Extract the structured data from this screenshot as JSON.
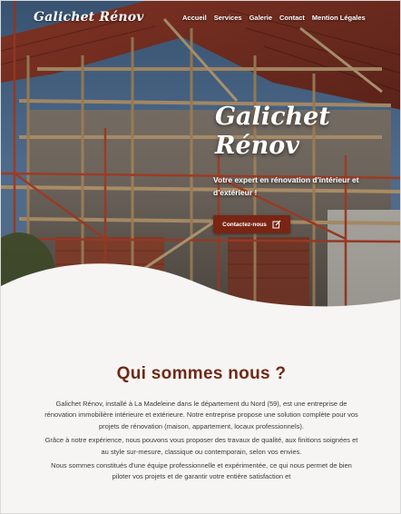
{
  "brand": {
    "logo_text": "Galichet Rénov"
  },
  "nav": {
    "items": [
      {
        "label": "Accueil"
      },
      {
        "label": "Services"
      },
      {
        "label": "Galerie"
      },
      {
        "label": "Contact"
      },
      {
        "label": "Mention Légales"
      }
    ]
  },
  "hero": {
    "title_line1": "Galichet",
    "title_line2": "Rénov",
    "subtitle": "Votre expert en rénovation d'intérieur et d'extérieur !",
    "cta_label": "Contactez-nous",
    "cta_icon": "edit-icon",
    "image_icon": "construction-house-photo"
  },
  "about": {
    "title": "Qui sommes nous ?",
    "paragraphs": [
      "Galichet Rénov, installé à La Madeleine dans le département du Nord (59), est une entreprise de rénovation immobilière intérieure et extérieure. Notre entreprise propose une solution complète pour vos projets de rénovation (maison, appartement, locaux professionnels).",
      "Grâce à notre expérience, nous pouvons vous proposer des travaux de qualité, aux finitions soignées et au style sur-mesure, classique ou contemporain, selon vos envies.",
      "Nous sommes constitués d'une équipe professionnelle et expérimentée, ce qui nous permet de bien piloter vos projets et de garantir votre entière satisfaction et"
    ]
  },
  "colors": {
    "accent": "#7a2514",
    "heading": "#6e2a17",
    "background": "#f7f5f3",
    "text": "#3a3a3a"
  }
}
